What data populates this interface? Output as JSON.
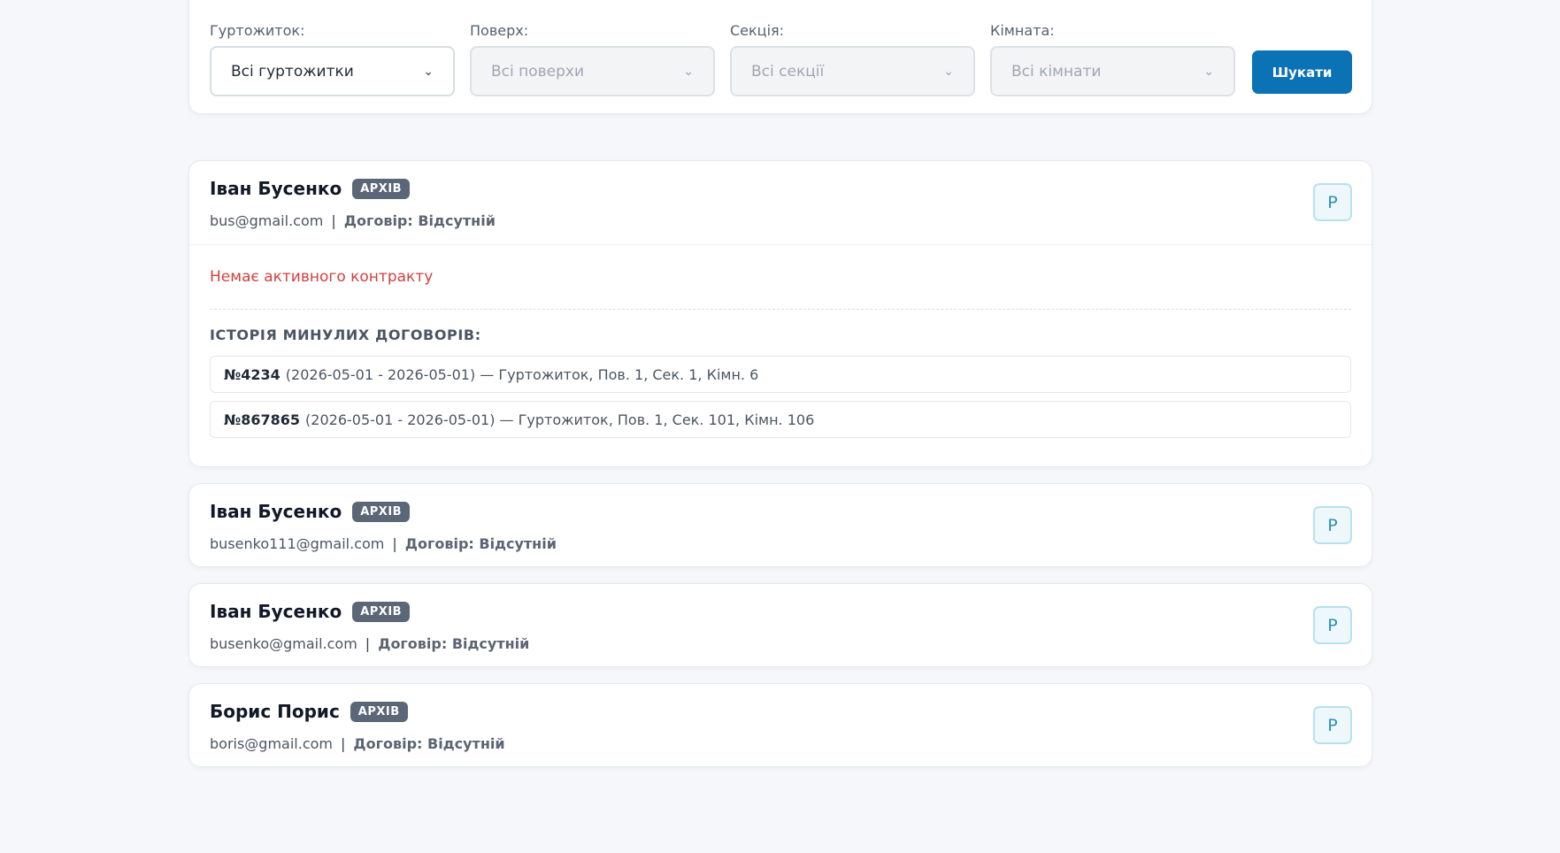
{
  "filters": {
    "dorm": {
      "label": "Гуртожиток:",
      "value": "Всі гуртожитки",
      "disabled": false
    },
    "floor": {
      "label": "Поверх:",
      "value": "Всі поверхи",
      "disabled": true
    },
    "section": {
      "label": "Секція:",
      "value": "Всі секції",
      "disabled": true
    },
    "room": {
      "label": "Кімната:",
      "value": "Всі кімнати",
      "disabled": true
    },
    "search_label": "Шукати"
  },
  "common": {
    "badge": "АРХІВ",
    "contract_prefix": "Договір:",
    "p_button": "P"
  },
  "students": [
    {
      "name": "Іван Бусенко",
      "email": "bus@gmail.com",
      "contract": "Відсутній",
      "no_contract_text": "Немає активного контракту",
      "history_title": "ІСТОРІЯ МИНУЛИХ ДОГОВОРІВ:",
      "history": [
        {
          "num": "№4234",
          "details": "(2026-05-01 - 2026-05-01) — Гуртожиток, Пов. 1, Сек. 1, Кімн. 6"
        },
        {
          "num": "№867865",
          "details": "(2026-05-01 - 2026-05-01) — Гуртожиток, Пов. 1, Сек. 101, Кімн. 106"
        }
      ]
    },
    {
      "name": "Іван Бусенко",
      "email": "busenko111@gmail.com",
      "contract": "Відсутній"
    },
    {
      "name": "Іван Бусенко",
      "email": "busenko@gmail.com",
      "contract": "Відсутній"
    },
    {
      "name": "Борис Порис",
      "email": "boris@gmail.com",
      "contract": "Відсутній"
    }
  ]
}
